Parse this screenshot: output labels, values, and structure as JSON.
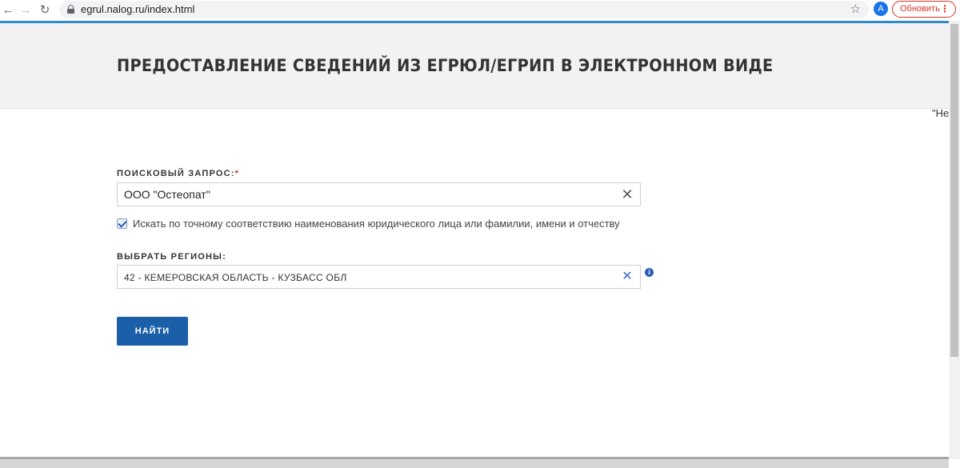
{
  "browser": {
    "url": "egrul.nalog.ru/index.html",
    "back_icon": "←",
    "forward_icon": "→",
    "reload_icon": "↻",
    "star_icon": "☆",
    "avatar_letter": "A",
    "update_label": "Обновить",
    "menu_icon": "⋮"
  },
  "header": {
    "title": "ПРЕДОСТАВЛЕНИЕ СВЕДЕНИЙ ИЗ ЕГРЮЛ/ЕГРИП В ЭЛЕКТРОННОМ ВИДЕ"
  },
  "overflow_text": "\"Невр",
  "form": {
    "query_label": "ПОИСКОВЫЙ ЗАПРОС:",
    "required_mark": "*",
    "query_value": "ООО \"Остеопат\"",
    "clear_icon": "✕",
    "exact_match_label": "Искать по точному соответствию наименования юридического лица или фамилии, имени и отчеству",
    "exact_match_checked": true,
    "region_label": "ВЫБРАТЬ РЕГИОНЫ:",
    "region_value": "42 - КЕМЕРОВСКАЯ ОБЛАСТЬ - КУЗБАСС ОБЛ",
    "info_icon": "i",
    "submit_label": "НАЙТИ"
  },
  "colors": {
    "accent": "#1a5fa8",
    "header_bg": "#f2f2f2",
    "required": "#c0392b",
    "chrome_accent": "#2f8cc7"
  }
}
